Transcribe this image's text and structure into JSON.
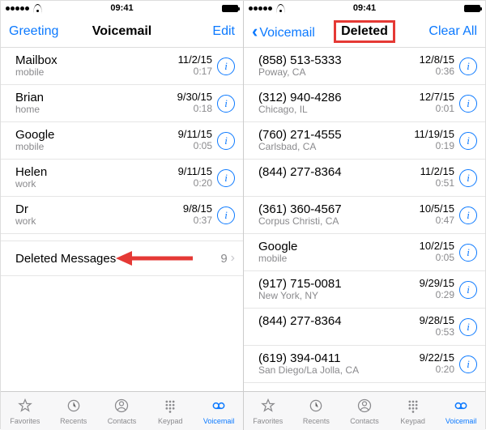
{
  "status": {
    "time": "09:41"
  },
  "left": {
    "nav": {
      "left": "Greeting",
      "title": "Voicemail",
      "right": "Edit"
    },
    "rows": [
      {
        "name": "Mailbox",
        "sub": "mobile",
        "date": "11/2/15",
        "dur": "0:17"
      },
      {
        "name": "Brian",
        "sub": "home",
        "date": "9/30/15",
        "dur": "0:18"
      },
      {
        "name": "Google",
        "sub": "mobile",
        "date": "9/11/15",
        "dur": "0:05"
      },
      {
        "name": "Helen",
        "sub": "work",
        "date": "9/11/15",
        "dur": "0:20"
      },
      {
        "name": "Dr",
        "sub": "work",
        "date": "9/8/15",
        "dur": "0:37"
      }
    ],
    "deleted": {
      "label": "Deleted Messages",
      "count": "9"
    }
  },
  "right": {
    "nav": {
      "back": "Voicemail",
      "title": "Deleted",
      "right": "Clear All"
    },
    "rows": [
      {
        "name": "(858) 513-5333",
        "sub": "Poway, CA",
        "date": "12/8/15",
        "dur": "0:36"
      },
      {
        "name": "(312) 940-4286",
        "sub": "Chicago, IL",
        "date": "12/7/15",
        "dur": "0:01"
      },
      {
        "name": "(760) 271-4555",
        "sub": "Carlsbad, CA",
        "date": "11/19/15",
        "dur": "0:19"
      },
      {
        "name": "(844) 277-8364",
        "sub": "",
        "date": "11/2/15",
        "dur": "0:51"
      },
      {
        "name": "(361) 360-4567",
        "sub": "Corpus Christi, CA",
        "date": "10/5/15",
        "dur": "0:47"
      },
      {
        "name": "Google",
        "sub": "mobile",
        "date": "10/2/15",
        "dur": "0:05"
      },
      {
        "name": "(917) 715-0081",
        "sub": "New York, NY",
        "date": "9/29/15",
        "dur": "0:29"
      },
      {
        "name": "(844) 277-8364",
        "sub": "",
        "date": "9/28/15",
        "dur": "0:53"
      },
      {
        "name": "(619) 394-0411",
        "sub": "San Diego/La Jolla, CA",
        "date": "9/22/15",
        "dur": "0:20"
      }
    ]
  },
  "tabs": {
    "favorites": "Favorites",
    "recents": "Recents",
    "contacts": "Contacts",
    "keypad": "Keypad",
    "voicemail": "Voicemail"
  },
  "annotations": {
    "highlight_title": true,
    "arrow_to_deleted": true
  }
}
